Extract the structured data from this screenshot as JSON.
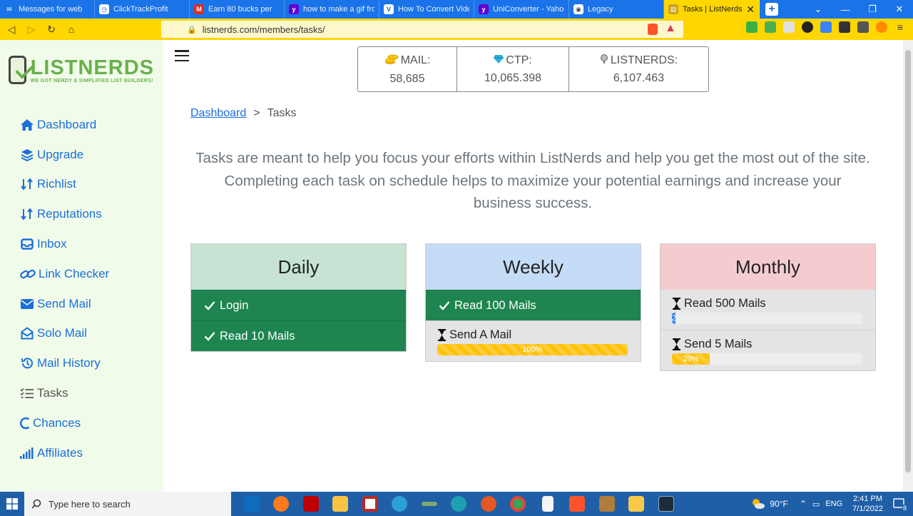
{
  "browser": {
    "tabs": [
      {
        "title": "Messages for web",
        "color": "#1a73e8"
      },
      {
        "title": "ClickTrackProfit",
        "color": "#3b5bdb"
      },
      {
        "title": "Earn 80 bucks per",
        "color": "#2e7d32"
      },
      {
        "title": "how to make a gif from",
        "color": "#6001d2"
      },
      {
        "title": "How To Convert Video",
        "color": "#1565c0"
      },
      {
        "title": "UniConverter - Yahoo",
        "color": "#6001d2"
      },
      {
        "title": "Legacy",
        "color": "#444444"
      },
      {
        "title": "Tasks | ListNerds",
        "color": "#c9a227",
        "active": true
      }
    ],
    "url": "listnerds.com/members/tasks/"
  },
  "logo": {
    "name": "LISTNERDS",
    "tagline": "WE GOT NERDY & SIMPLIFIED LIST BUILDERS!"
  },
  "sidebar": {
    "items": [
      {
        "label": "Dashboard",
        "icon": "home-icon"
      },
      {
        "label": "Upgrade",
        "icon": "layers-icon"
      },
      {
        "label": "Richlist",
        "icon": "sort-icon"
      },
      {
        "label": "Reputations",
        "icon": "sort-icon"
      },
      {
        "label": "Inbox",
        "icon": "inbox-icon"
      },
      {
        "label": "Link Checker",
        "icon": "link-icon"
      },
      {
        "label": "Send Mail",
        "icon": "envelope-icon"
      },
      {
        "label": "Solo Mail",
        "icon": "envelope-open-icon"
      },
      {
        "label": "Mail History",
        "icon": "history-icon"
      },
      {
        "label": "Tasks",
        "icon": "tasks-icon",
        "current": true
      },
      {
        "label": "Chances",
        "icon": "c-icon"
      },
      {
        "label": "Affiliates",
        "icon": "signal-icon"
      }
    ]
  },
  "stats": [
    {
      "label": "MAIL:",
      "value": "58,685",
      "icon": "coins-icon"
    },
    {
      "label": "CTP:",
      "value": "10,065.398",
      "icon": "gem-icon"
    },
    {
      "label": "LISTNERDS:",
      "value": "6,107.463",
      "icon": "nerd-icon"
    }
  ],
  "breadcrumb": {
    "home": "Dashboard",
    "separator": ">",
    "current": "Tasks"
  },
  "intro": "Tasks are meant to help you focus your efforts within ListNerds and help you get the most out of the site. Completing each task on schedule helps to maximize your potential earnings and increase your business success.",
  "cards": {
    "daily": {
      "title": "Daily",
      "header_color": "#c6e3d4",
      "tasks": [
        {
          "label": "Login",
          "status": "done"
        },
        {
          "label": "Read 10 Mails",
          "status": "done"
        }
      ]
    },
    "weekly": {
      "title": "Weekly",
      "header_color": "#c5dcf7",
      "tasks": [
        {
          "label": "Read 100 Mails",
          "status": "done"
        },
        {
          "label": "Send A Mail",
          "status": "progress",
          "progress": 100,
          "progress_text": "100%",
          "bar_color": "#ffc107"
        }
      ]
    },
    "monthly": {
      "title": "Monthly",
      "header_color": "#f4cccf",
      "tasks": [
        {
          "label": "Read 500 Mails",
          "status": "progress",
          "progress": 2,
          "progress_text": "2",
          "bar_color": "#1a73e8"
        },
        {
          "label": "Send 5 Mails",
          "status": "progress",
          "progress": 20,
          "progress_text": "20%",
          "bar_color": "#ffc107"
        }
      ]
    }
  },
  "taskbar": {
    "search_placeholder": "Type here to search",
    "weather": "90°F",
    "language": "ENG",
    "time": "2:41 PM",
    "date": "7/1/2022",
    "notifications": "8"
  }
}
